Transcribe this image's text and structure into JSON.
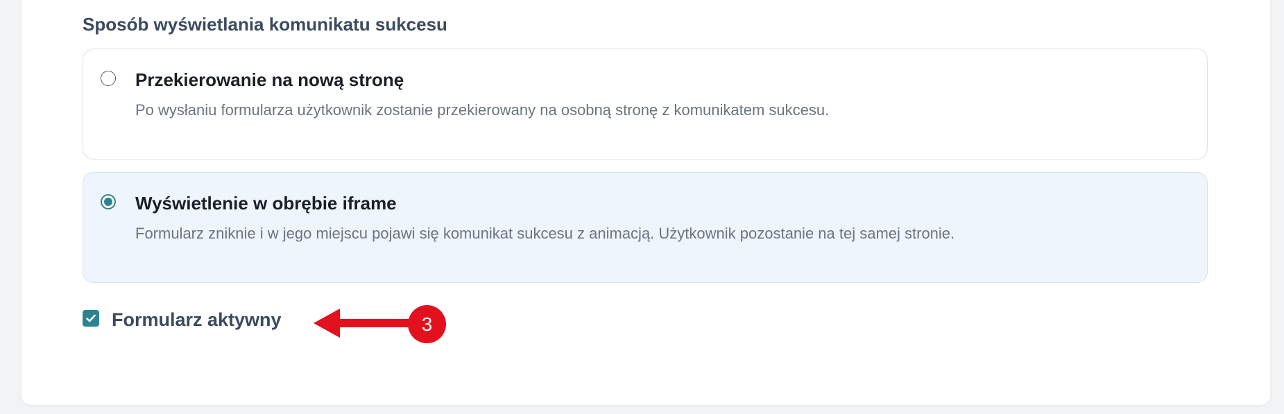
{
  "section": {
    "title": "Sposób wyświetlania komunikatu sukcesu"
  },
  "options": [
    {
      "title": "Przekierowanie na nową stronę",
      "description": "Po wysłaniu formularza użytkownik zostanie przekierowany na osobną stronę z komunikatem sukcesu.",
      "selected": false
    },
    {
      "title": "Wyświetlenie w obrębie iframe",
      "description": "Formularz zniknie i w jego miejscu pojawi się komunikat sukcesu z animacją. Użytkownik pozostanie na tej samej stronie.",
      "selected": true
    }
  ],
  "active_checkbox": {
    "label": "Formularz aktywny",
    "checked": true
  },
  "annotation": {
    "number": "3",
    "color": "#e3101d"
  },
  "colors": {
    "accent": "#2b8490",
    "selected_bg": "#eef5fd",
    "heading": "#3b4a5e"
  },
  "icons": {
    "radio_unchecked": "radio-empty-icon",
    "radio_checked": "radio-selected-icon",
    "checkbox_checked": "checkmark-icon",
    "annotation_arrow": "arrow-left-icon"
  }
}
